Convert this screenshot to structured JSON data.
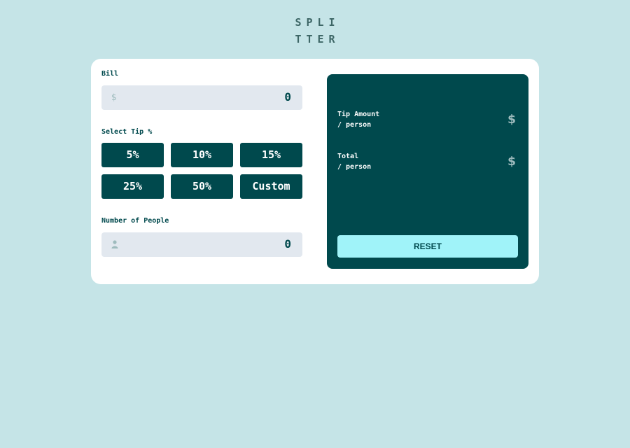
{
  "logo": {
    "line1": "SPLI",
    "line2": "TTER"
  },
  "bill": {
    "label": "Bill",
    "icon": "$",
    "value": "0"
  },
  "tip": {
    "label": "Select Tip %",
    "options": [
      "5%",
      "10%",
      "15%",
      "25%",
      "50%"
    ],
    "custom_label": "Custom"
  },
  "people": {
    "label": "Number of People",
    "value": "0"
  },
  "results": {
    "tip_amount": {
      "label_line1": "Tip Amount",
      "label_line2": "/ person",
      "value": "$"
    },
    "total": {
      "label_line1": "Total",
      "label_line2": "/ person",
      "value": "$"
    },
    "reset_label": "RESET"
  },
  "colors": {
    "background": "#c5e4e7",
    "dark_cyan": "#00494d",
    "input_bg": "#e2e8ef",
    "reset_bg": "#a0f3f9",
    "muted": "#9ebbbd"
  }
}
